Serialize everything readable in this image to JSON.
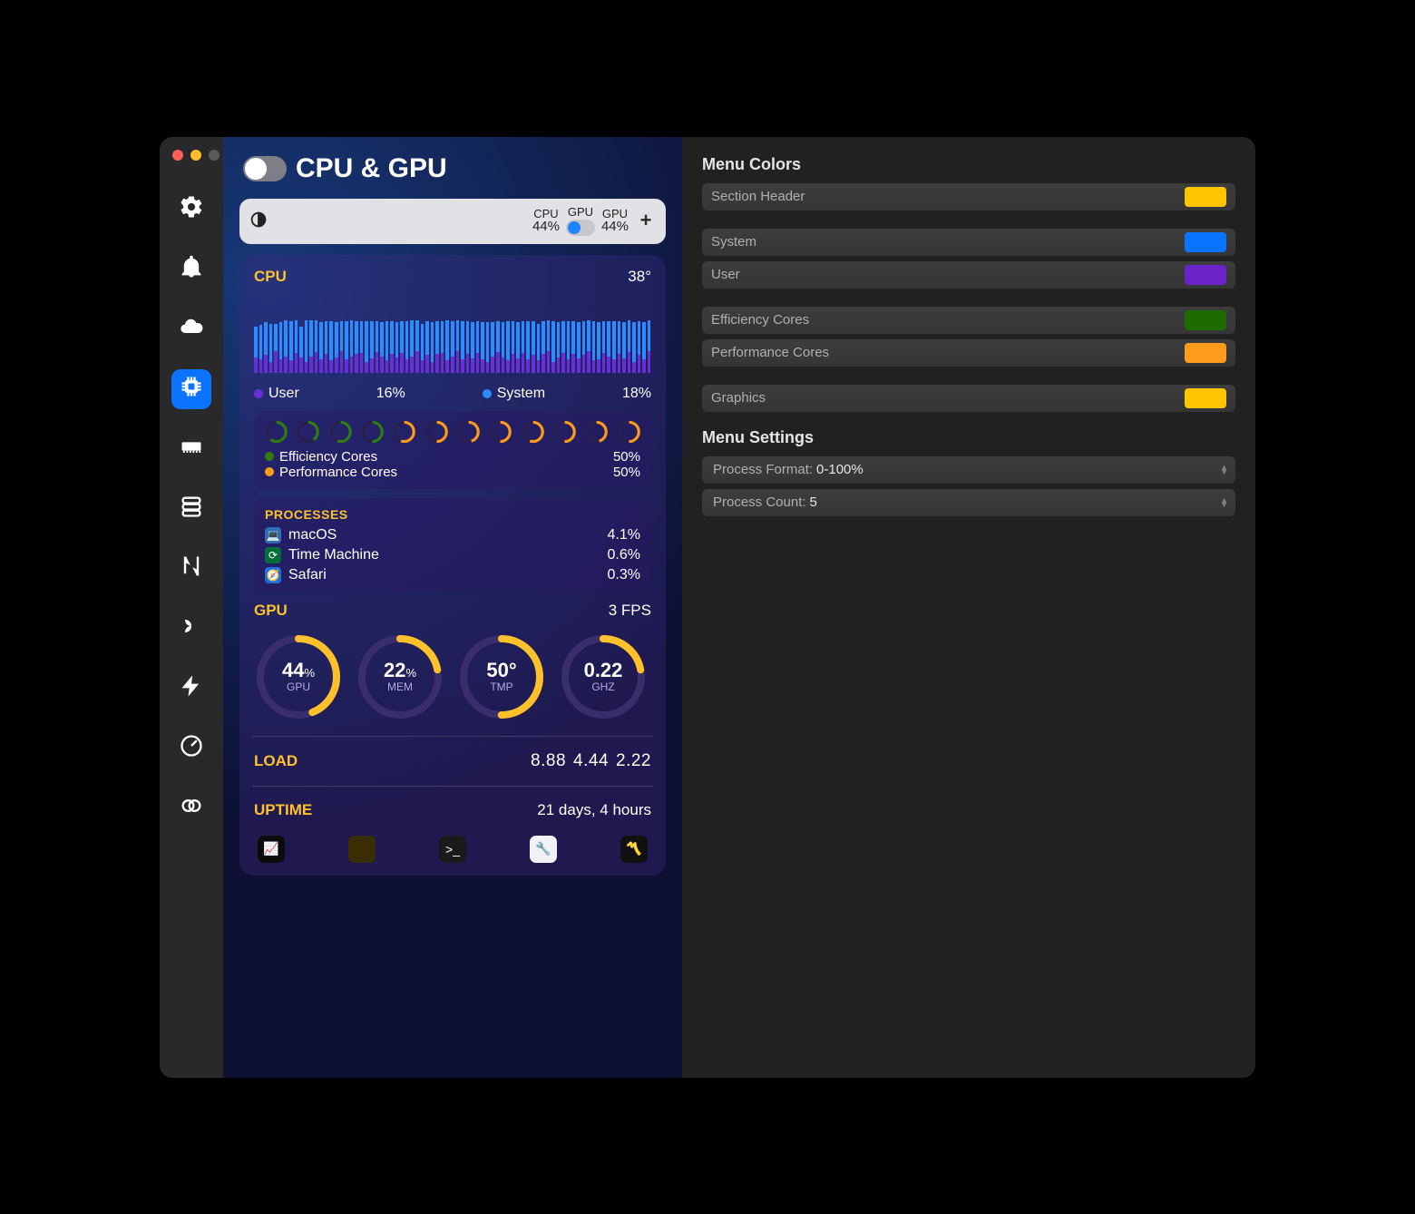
{
  "window": {
    "traffic": {
      "close": "#ff5f57",
      "min": "#febc2e",
      "max": "#5a5a5d"
    }
  },
  "page": {
    "title": "CPU & GPU"
  },
  "menubar_preview": {
    "cpu_label": "CPU",
    "cpu_value": "44%",
    "gpu_label": "GPU",
    "gpu_toggle_on": true,
    "gpu2_label": "GPU",
    "gpu2_value": "44%"
  },
  "cpu_section": {
    "title": "CPU",
    "temp": "38°",
    "user_label": "User",
    "user_pct": "16%",
    "system_label": "System",
    "system_pct": "18%",
    "legend_colors": {
      "user": "#6a2ed9",
      "system": "#2b8bff"
    }
  },
  "cores": {
    "eff_label": "Efficiency Cores",
    "eff_pct": "50%",
    "eff_color": "#2e7d0f",
    "perf_label": "Performance Cores",
    "perf_pct": "50%",
    "perf_color": "#ff9b1a",
    "rings": [
      {
        "c": "#2e7d0f",
        "p": 0.6
      },
      {
        "c": "#2e7d0f",
        "p": 0.4
      },
      {
        "c": "#2e7d0f",
        "p": 0.55
      },
      {
        "c": "#2e7d0f",
        "p": 0.5
      },
      {
        "c": "#ff9b1a",
        "p": 0.55
      },
      {
        "c": "#ff9b1a",
        "p": 0.5
      },
      {
        "c": "#ff9b1a",
        "p": 0.45
      },
      {
        "c": "#ff9b1a",
        "p": 0.5
      },
      {
        "c": "#ff9b1a",
        "p": 0.55
      },
      {
        "c": "#ff9b1a",
        "p": 0.5
      },
      {
        "c": "#ff9b1a",
        "p": 0.45
      },
      {
        "c": "#ff9b1a",
        "p": 0.5
      }
    ]
  },
  "processes": {
    "title": "PROCESSES",
    "items": [
      {
        "icon_bg": "#2f6db8",
        "icon_tx": "💻",
        "name": "macOS",
        "value": "4.1%"
      },
      {
        "icon_bg": "#066c3a",
        "icon_tx": "⟳",
        "name": "Time Machine",
        "value": "0.6%"
      },
      {
        "icon_bg": "#1c6fe0",
        "icon_tx": "🧭",
        "name": "Safari",
        "value": "0.3%"
      }
    ]
  },
  "gpu_section": {
    "title": "GPU",
    "fps": "3 FPS",
    "rings": [
      {
        "big": "44",
        "pct": "%",
        "sub": "GPU",
        "p": 0.44
      },
      {
        "big": "22",
        "pct": "%",
        "sub": "MEM",
        "p": 0.22
      },
      {
        "big": "50°",
        "pct": "",
        "sub": "TMP",
        "p": 0.5
      },
      {
        "big": "0.22",
        "pct": "",
        "sub": "GHZ",
        "p": 0.22
      }
    ]
  },
  "load": {
    "label": "LOAD",
    "v1": "8.88",
    "v2": "4.44",
    "v3": "2.22"
  },
  "uptime": {
    "label": "UPTIME",
    "value": "21 days, 4 hours"
  },
  "dock_apps": [
    {
      "bg": "#0c0c0c",
      "tx": "📈"
    },
    {
      "bg": "#3a2e00",
      "tx": ""
    },
    {
      "bg": "#1a1a1a",
      "tx": ">_"
    },
    {
      "bg": "#f2f2f6",
      "tx": "🔧"
    },
    {
      "bg": "#111",
      "tx": "〽️"
    }
  ],
  "right": {
    "colors_title": "Menu Colors",
    "colors": [
      {
        "label": "Section Header",
        "hex": "#ffc500"
      },
      null,
      {
        "label": "System",
        "hex": "#0a74ff"
      },
      {
        "label": "User",
        "hex": "#6a23c8"
      },
      null,
      {
        "label": "Efficiency Cores",
        "hex": "#1e6b00"
      },
      {
        "label": "Performance Cores",
        "hex": "#ff9b1a"
      },
      null,
      {
        "label": "Graphics",
        "hex": "#ffc500"
      }
    ],
    "settings_title": "Menu Settings",
    "settings": [
      {
        "label": "Process Format:",
        "value": "0-100%"
      },
      {
        "label": "Process Count:",
        "value": "5"
      }
    ]
  },
  "chart_data": {
    "type": "bar",
    "title": "CPU usage over time (stacked User+System)",
    "ylabel": "%",
    "ylim": [
      0,
      100
    ],
    "series": [
      {
        "name": "System",
        "color": "#2b8bff",
        "values": [
          28,
          32,
          30,
          35,
          25,
          34,
          33,
          36,
          30,
          28,
          38,
          33,
          29,
          34,
          30,
          36,
          32,
          27,
          35,
          33,
          30,
          29,
          37,
          34,
          28,
          31,
          36,
          30,
          32,
          29,
          35,
          33,
          28,
          34,
          31,
          36,
          30,
          29,
          37,
          32,
          28,
          35,
          30,
          33,
          29,
          34,
          36,
          31,
          28,
          32,
          36,
          30,
          33,
          29,
          35,
          31,
          34,
          30,
          28,
          37,
          32,
          29,
          35,
          30,
          33,
          31,
          28,
          36,
          34,
          29,
          32,
          35,
          30,
          33,
          29,
          36,
          31,
          34,
          28
        ]
      },
      {
        "name": "User",
        "color": "#6a2ed9",
        "values": [
          14,
          12,
          16,
          10,
          20,
          12,
          15,
          11,
          18,
          14,
          10,
          15,
          19,
          12,
          17,
          11,
          14,
          20,
          12,
          15,
          17,
          18,
          10,
          13,
          19,
          15,
          11,
          17,
          14,
          18,
          12,
          15,
          20,
          11,
          16,
          10,
          17,
          18,
          11,
          15,
          20,
          12,
          17,
          13,
          18,
          12,
          10,
          15,
          19,
          14,
          11,
          17,
          13,
          18,
          12,
          16,
          11,
          17,
          20,
          10,
          14,
          18,
          12,
          17,
          13,
          16,
          20,
          11,
          12,
          18,
          15,
          12,
          17,
          13,
          19,
          10,
          16,
          12,
          20
        ]
      }
    ]
  }
}
